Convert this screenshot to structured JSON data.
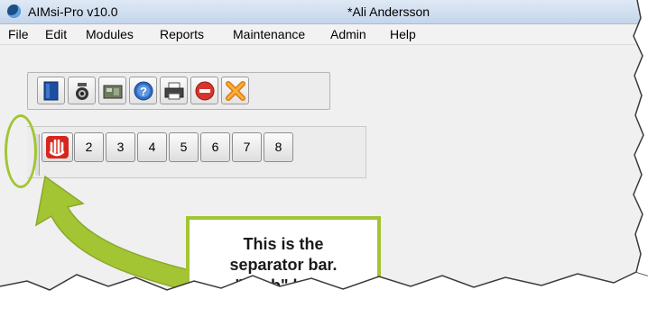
{
  "window": {
    "app_title": "AIMsi-Pro v10.0",
    "document_title": "*Ali Andersson"
  },
  "menu": {
    "items": [
      "File",
      "Edit",
      "Modules",
      "Reports",
      "Maintenance",
      "Admin",
      "Help"
    ]
  },
  "toolbar1": {
    "icons": [
      "new-document-icon",
      "camera-icon",
      "cash-register-icon",
      "help-icon",
      "printer-icon",
      "stop-icon",
      "close-icon"
    ]
  },
  "toolbar2": {
    "first_icon": "hand-icon",
    "buttons": [
      "2",
      "3",
      "4",
      "5",
      "6",
      "7",
      "8"
    ]
  },
  "callout": {
    "line1": "This is the",
    "line2": "separator bar.",
    "line3": "\"Grab\" here."
  },
  "colors": {
    "callout_green": "#a3c533",
    "titlebar": "#c4d5ea"
  }
}
